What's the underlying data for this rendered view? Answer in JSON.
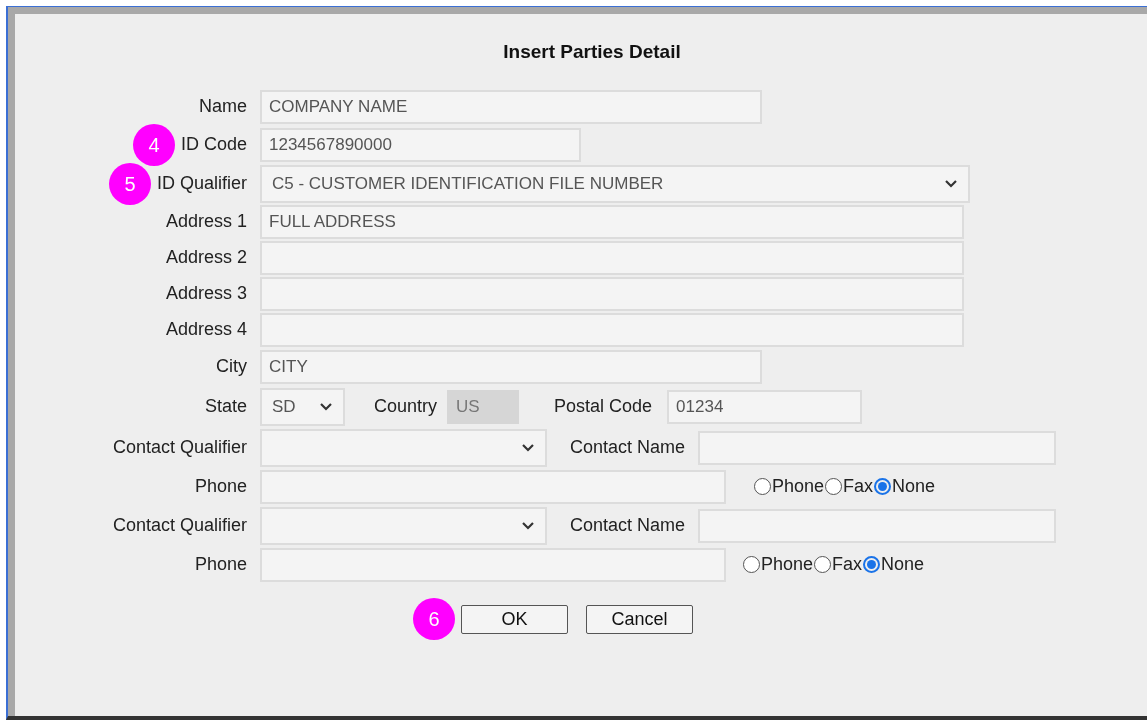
{
  "title": "Insert Parties Detail",
  "name": {
    "label": "Name",
    "value": "COMPANY NAME"
  },
  "id_code": {
    "label": "ID Code",
    "value": "1234567890000",
    "callout": "4"
  },
  "id_qualifier": {
    "label": "ID Qualifier",
    "value": "C5 - CUSTOMER IDENTIFICATION FILE NUMBER",
    "callout": "5"
  },
  "addresses": [
    {
      "label": "Address 1",
      "value": "FULL ADDRESS"
    },
    {
      "label": "Address 2"
    },
    {
      "label": "Address 3"
    },
    {
      "label": "Address 4"
    }
  ],
  "city": {
    "label": "City",
    "value": "CITY"
  },
  "state": {
    "label": "State",
    "value": "SD"
  },
  "country": {
    "label": "Country",
    "value": "US",
    "disabled": true
  },
  "postal_code": {
    "label": "Postal Code",
    "value": "01234",
    "disabled": false
  },
  "contacts": [
    {
      "qualifier_label": "Contact Qualifier",
      "name_label": "Contact Name",
      "phone_label": "Phone",
      "options": [
        {
          "label": "Phone",
          "selected": false
        },
        {
          "label": "Fax",
          "selected": false
        },
        {
          "label": "None",
          "selected": true
        }
      ]
    },
    {
      "qualifier_label": "Contact Qualifier",
      "name_label": "Contact Name",
      "phone_label": "Phone",
      "options": [
        {
          "label": "Phone",
          "selected": false
        },
        {
          "label": "Fax",
          "selected": false
        },
        {
          "label": "None",
          "selected": true
        }
      ]
    }
  ],
  "buttons": [
    {
      "label": "OK",
      "callout": "6"
    },
    {
      "label": "Cancel"
    }
  ]
}
